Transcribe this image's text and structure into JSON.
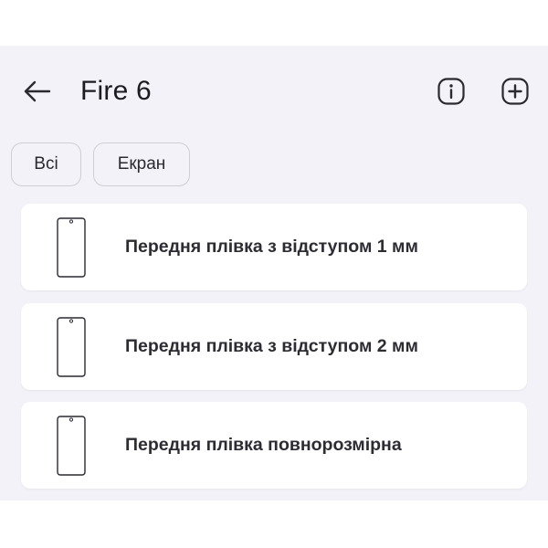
{
  "header": {
    "back_icon": "arrow-left-icon",
    "title": "Fire 6",
    "info_icon": "info-circle-icon",
    "add_icon": "add-square-icon"
  },
  "filters": {
    "chips": [
      {
        "label": "Всі"
      },
      {
        "label": "Екран"
      }
    ]
  },
  "items": [
    {
      "icon": "phone-outline-icon",
      "label": "Передня плівка з відступом 1 мм"
    },
    {
      "icon": "phone-outline-icon",
      "label": "Передня плівка з відступом 2 мм"
    },
    {
      "icon": "phone-outline-icon",
      "label": "Передня плівка повнорозмірна"
    }
  ],
  "colors": {
    "background": "#f3f2f8",
    "card": "#ffffff",
    "text": "#1c1b1f",
    "chip_border": "#cfcdd6"
  }
}
